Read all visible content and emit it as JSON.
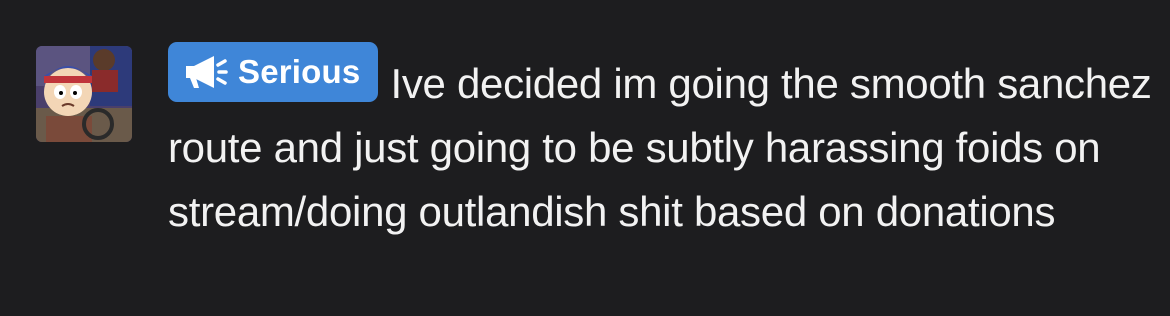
{
  "post": {
    "avatar_icon": "user-avatar-image",
    "tag": {
      "icon": "megaphone-icon",
      "label": "Serious",
      "color": "#3f86d8"
    },
    "text": "Ive decided im going the smooth sanchez route and just going to be subtly harassing foids on stream/doing outlandish shit based on donations"
  }
}
